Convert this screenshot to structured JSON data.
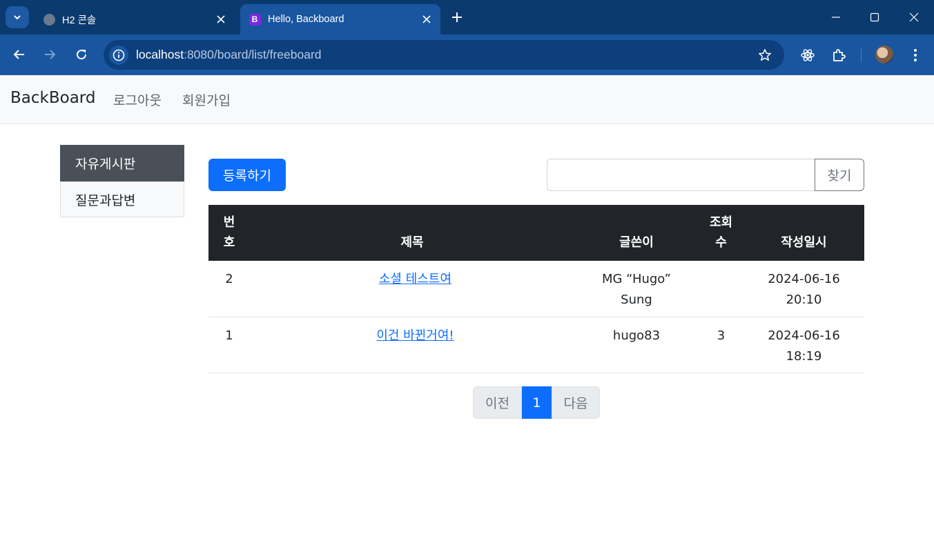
{
  "browser": {
    "tabs": [
      {
        "title": "H2 콘솔",
        "active": false,
        "favicon": "globe-icon"
      },
      {
        "title": "Hello, Backboard",
        "active": true,
        "favicon": "bootstrap-icon"
      }
    ],
    "url": {
      "host": "localhost",
      "rest": ":8080/board/list/freeboard"
    },
    "colors": {
      "tabbar": "#0b3a6e",
      "toolbar": "#1a56a0",
      "omnibox": "#0d3f7c"
    }
  },
  "navbar": {
    "brand": "BackBoard",
    "links": [
      "로그아웃",
      "회원가입"
    ]
  },
  "sidebar": {
    "items": [
      {
        "label": "자유게시판",
        "active": true
      },
      {
        "label": "질문과답변",
        "active": false
      }
    ]
  },
  "actions": {
    "register_label": "등록하기",
    "search_value": "",
    "search_button": "찾기"
  },
  "table": {
    "headers": {
      "no": [
        "번",
        "호"
      ],
      "title": "제목",
      "writer": "글쓴이",
      "views": [
        "조회",
        "수"
      ],
      "date": "작성일시"
    },
    "rows": [
      {
        "no": "2",
        "title": "소셜 테스트여",
        "writer": [
          "MG “Hugo”",
          "Sung"
        ],
        "views": "",
        "date": [
          "2024-06-16",
          "20:10"
        ]
      },
      {
        "no": "1",
        "title": "이건 바뀐거여!",
        "writer": [
          "hugo83"
        ],
        "views": "3",
        "date": [
          "2024-06-16",
          "18:19"
        ]
      }
    ]
  },
  "pagination": {
    "prev": "이전",
    "current": "1",
    "next": "다음"
  },
  "colors": {
    "primary": "#0d6efd",
    "dark": "#212529",
    "sidebar_active": "#495057",
    "navbar_bg": "#f8f9fa"
  }
}
